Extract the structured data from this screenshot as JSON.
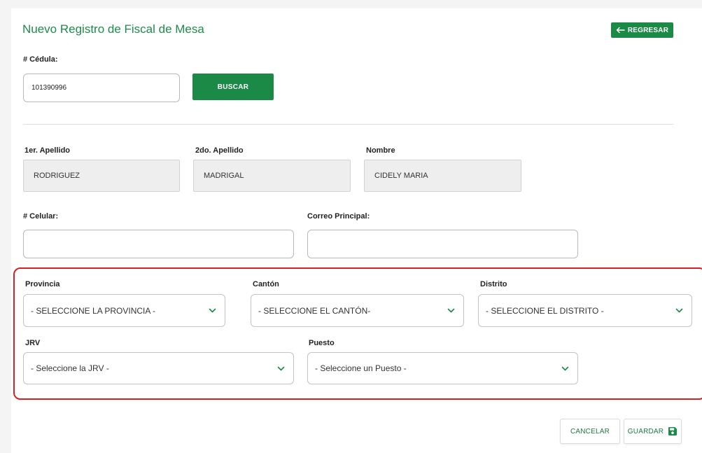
{
  "page": {
    "title": "Nuevo Registro de Fiscal de Mesa",
    "back_label": "REGRESAR"
  },
  "search": {
    "cedula_label": "# Cédula:",
    "cedula_value": "101390996",
    "search_label": "BUSCAR"
  },
  "person": {
    "apellido1_label": "1er. Apellido",
    "apellido1_value": "RODRIGUEZ",
    "apellido2_label": "2do. Apellido",
    "apellido2_value": "MADRIGAL",
    "nombre_label": "Nombre",
    "nombre_value": "CIDELY MARIA"
  },
  "contact": {
    "celular_label": "# Celular:",
    "celular_value": "",
    "correo_label": "Correo Principal:",
    "correo_value": ""
  },
  "location": {
    "provincia_label": "Provincia",
    "provincia_selected": "- SELECCIONE LA PROVINCIA -",
    "canton_label": "Cantón",
    "canton_selected": "- SELECCIONE EL CANTÓN-",
    "distrito_label": "Distrito",
    "distrito_selected": "- SELECCIONE EL DISTRITO -",
    "jrv_label": "JRV",
    "jrv_selected": "- Seleccione la JRV -",
    "puesto_label": "Puesto",
    "puesto_selected": "- Seleccione un Puesto -"
  },
  "actions": {
    "cancel_label": "CANCELAR",
    "save_label": "GUARDAR"
  },
  "icons": {
    "back": "arrow-left-icon",
    "dropdown": "chevron-down-icon",
    "save": "floppy-disk-icon"
  },
  "colors": {
    "primary_green": "#1b8a47",
    "title_green": "#1f8a4c",
    "highlight_red": "#d81f26",
    "readonly_gray": "#eeeeee"
  }
}
